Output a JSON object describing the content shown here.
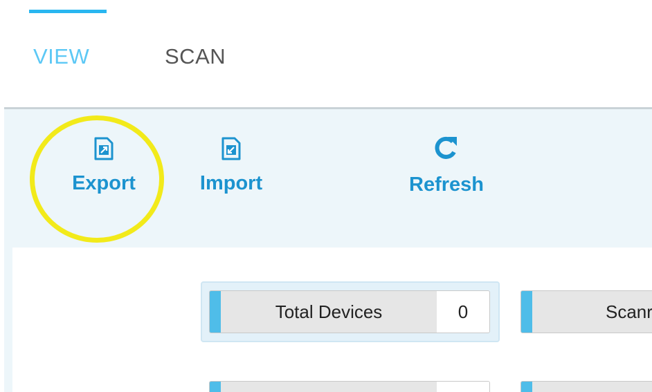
{
  "tabs": [
    {
      "label": "VIEW",
      "active": true
    },
    {
      "label": "SCAN",
      "active": false
    }
  ],
  "toolbar": {
    "export_label": "Export",
    "import_label": "Import",
    "refresh_label": "Refresh"
  },
  "stats": {
    "total_devices_label": "Total Devices",
    "total_devices_value": "0",
    "scanned_label": "Scanr"
  },
  "colors": {
    "accent": "#29b6f0",
    "highlight": "#f2ea1a",
    "tool_text": "#1c93cf"
  }
}
